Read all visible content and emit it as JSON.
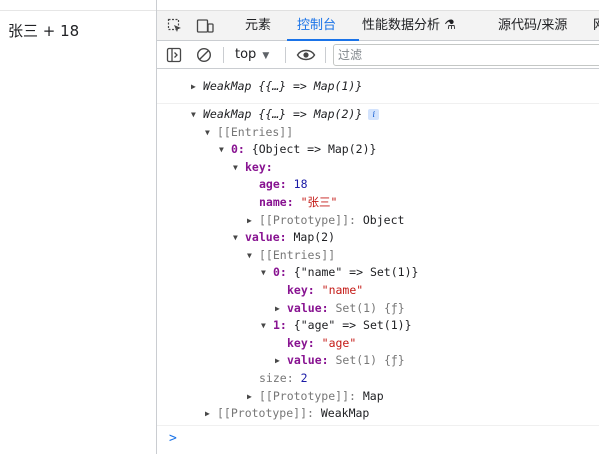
{
  "page": {
    "text": "张三 + 18"
  },
  "devtools": {
    "tabs": [
      {
        "label": "元素"
      },
      {
        "label": "控制台"
      },
      {
        "label": "性能数据分析 ⚗"
      },
      {
        "label": "源代码/来源"
      },
      {
        "label": "网"
      }
    ],
    "context": "top",
    "filter_placeholder": "过滤",
    "prompt": ">"
  },
  "console": {
    "collapsed": {
      "label": "WeakMap {{…} => Map(1)}"
    },
    "expanded": {
      "label": "WeakMap {{…} => Map(2)}",
      "info": "i",
      "entries_label": "[[Entries]]",
      "entry0": {
        "index": "0:",
        "summary": "{Object => Map(2)}",
        "key_label": "key:",
        "age_key": "age:",
        "age_val": "18",
        "name_key": "name:",
        "name_val": "\"张三\"",
        "proto_label": "[[Prototype]]:",
        "proto_val": "Object",
        "value_label": "value:",
        "value_summary": "Map(2)",
        "map_entries_label": "[[Entries]]",
        "m0_index": "0:",
        "m0_summary": "{\"name\" => Set(1)}",
        "m0_key_label": "key:",
        "m0_key_val": "\"name\"",
        "m0_value_label": "value:",
        "m0_value_val": "Set(1) {ƒ}",
        "m1_index": "1:",
        "m1_summary": "{\"age\" => Set(1)}",
        "m1_key_label": "key:",
        "m1_key_val": "\"age\"",
        "m1_value_label": "value:",
        "m1_value_val": "Set(1) {ƒ}",
        "size_label": "size:",
        "size_val": "2",
        "map_proto_label": "[[Prototype]]:",
        "map_proto_val": "Map"
      },
      "proto_label": "[[Prototype]]:",
      "proto_val": "WeakMap"
    }
  }
}
